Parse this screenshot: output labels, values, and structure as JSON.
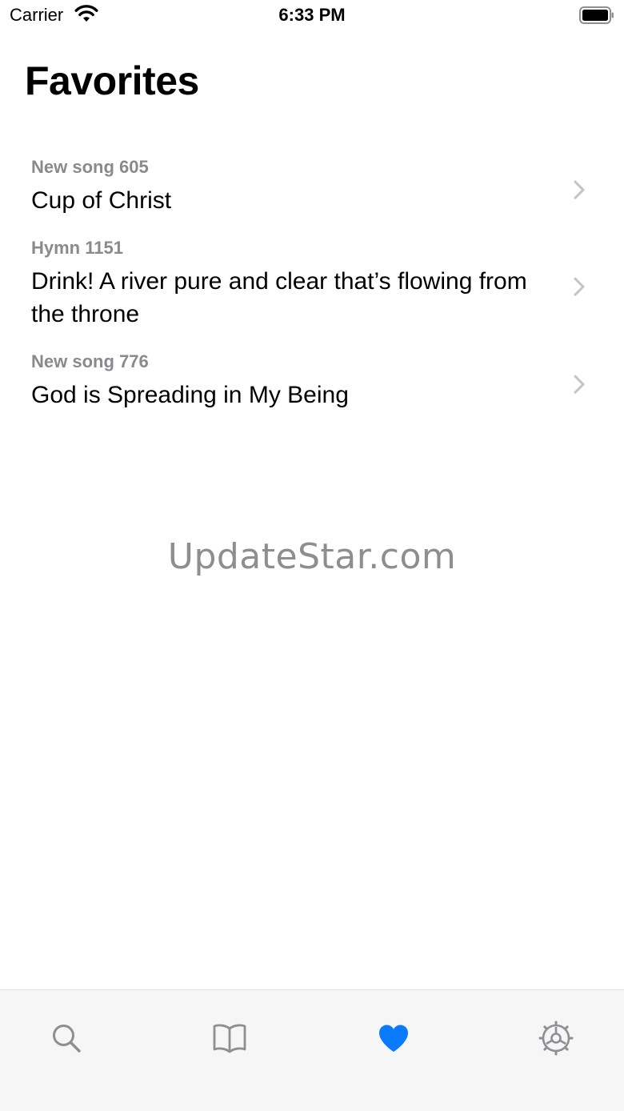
{
  "status_bar": {
    "carrier": "Carrier",
    "time": "6:33 PM"
  },
  "page": {
    "title": "Favorites"
  },
  "favorites": [
    {
      "subtitle": "New song 605",
      "title": "Cup of Christ"
    },
    {
      "subtitle": "Hymn 1151",
      "title": "Drink! A river pure and clear that’s flowing from the throne"
    },
    {
      "subtitle": "New song 776",
      "title": "God is Spreading in My Being"
    }
  ],
  "watermark": "UpdateStar.com",
  "tab_bar": {
    "tabs": [
      {
        "icon": "search-icon",
        "selected": false
      },
      {
        "icon": "book-icon",
        "selected": false
      },
      {
        "icon": "heart-icon",
        "selected": true
      },
      {
        "icon": "gear-icon",
        "selected": false
      }
    ]
  },
  "colors": {
    "accent": "#0a7aff",
    "secondary_text": "#8a8a8e",
    "tab_inactive": "#8e8e93",
    "tab_bar_bg": "#f6f6f6"
  }
}
